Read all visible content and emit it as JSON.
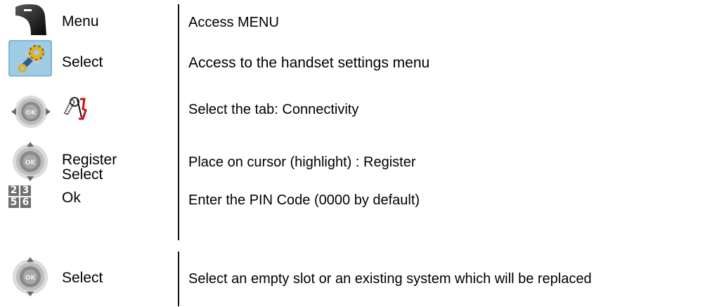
{
  "rows": [
    {
      "icon": "soft-key-icon",
      "key": "Menu",
      "description": "Access MENU"
    },
    {
      "icon": "settings-tools-icon",
      "key": "Select",
      "description": "Access to the handset settings menu"
    },
    {
      "icon": "navigation-left-right-icon",
      "key_icon": "connectivity-tab-icon",
      "description": "Select the tab: Connectivity"
    },
    {
      "icon": "navigation-up-down-icon",
      "key_lines": [
        "Register",
        "Select"
      ],
      "description": "Place on cursor (highlight) : Register"
    },
    {
      "icon": "keypad-icon",
      "keypad_digits": [
        "2",
        "3",
        "5",
        "6"
      ],
      "key": "Ok",
      "description": "Enter the PIN Code (0000 by default)"
    },
    {
      "icon": "navigation-up-down-icon",
      "key": "Select",
      "description": "Select an empty slot or an existing system which will be replaced"
    }
  ]
}
